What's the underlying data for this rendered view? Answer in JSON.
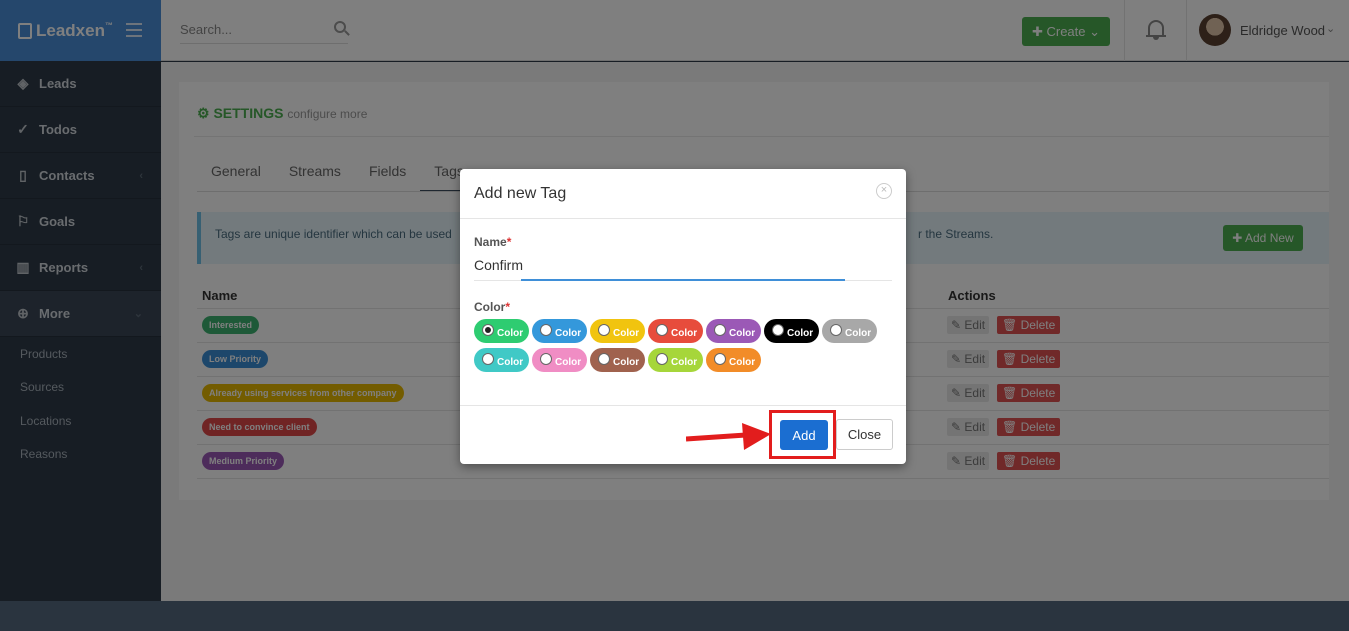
{
  "brand": {
    "name": "Leadxen",
    "tm": "™"
  },
  "sidebar": {
    "items": [
      {
        "label": "Leads",
        "icon": "layers-icon"
      },
      {
        "label": "Todos",
        "icon": "check-circle-icon"
      },
      {
        "label": "Contacts",
        "icon": "book-icon"
      },
      {
        "label": "Goals",
        "icon": "flag-icon"
      },
      {
        "label": "Reports",
        "icon": "bar-chart-icon"
      },
      {
        "label": "More",
        "icon": "plus-circle-icon"
      }
    ],
    "sub_items": [
      "Products",
      "Sources",
      "Locations",
      "Reasons"
    ]
  },
  "topbar": {
    "search_placeholder": "Search...",
    "create_label": "✚ Create ⌄",
    "user_name": "Eldridge Wood",
    "caret": "⌄"
  },
  "settings": {
    "title": "SETTINGS",
    "subtitle": "configure more",
    "tabs": [
      "General",
      "Streams",
      "Fields",
      "Tags"
    ],
    "info_text_left": "Tags are unique identifier which can be used",
    "info_text_right": "r the Streams.",
    "add_new_label": "✚ Add New",
    "columns": {
      "name": "Name",
      "actions": "Actions"
    },
    "rows": [
      {
        "name": "Interested",
        "color": "#3cb371"
      },
      {
        "name": "Low Priority",
        "color": "#3a8fd6"
      },
      {
        "name": "Already using services from other company",
        "color": "#e6b800"
      },
      {
        "name": "Need to convince client",
        "color": "#e04848"
      },
      {
        "name": "Medium Priority",
        "color": "#9b59b6"
      }
    ],
    "edit_label": "✎ Edit",
    "delete_label": "🗑 Delete"
  },
  "modal": {
    "title": "Add new Tag",
    "close_icon": "×",
    "name_label": "Name",
    "required_mark": "*",
    "name_value": "Confirm",
    "color_label": "Color",
    "swatch_label": "Color",
    "colors": [
      "#2ecc71",
      "#3498db",
      "#f1c40f",
      "#e74c3c",
      "#9b59b6",
      "#000000",
      "#a8a8a8",
      "#40c9c6",
      "#f08dc4",
      "#a0624e",
      "#a6d63a",
      "#f28c28"
    ],
    "selected_index": 0,
    "add_label": "Add",
    "close_label": "Close"
  }
}
